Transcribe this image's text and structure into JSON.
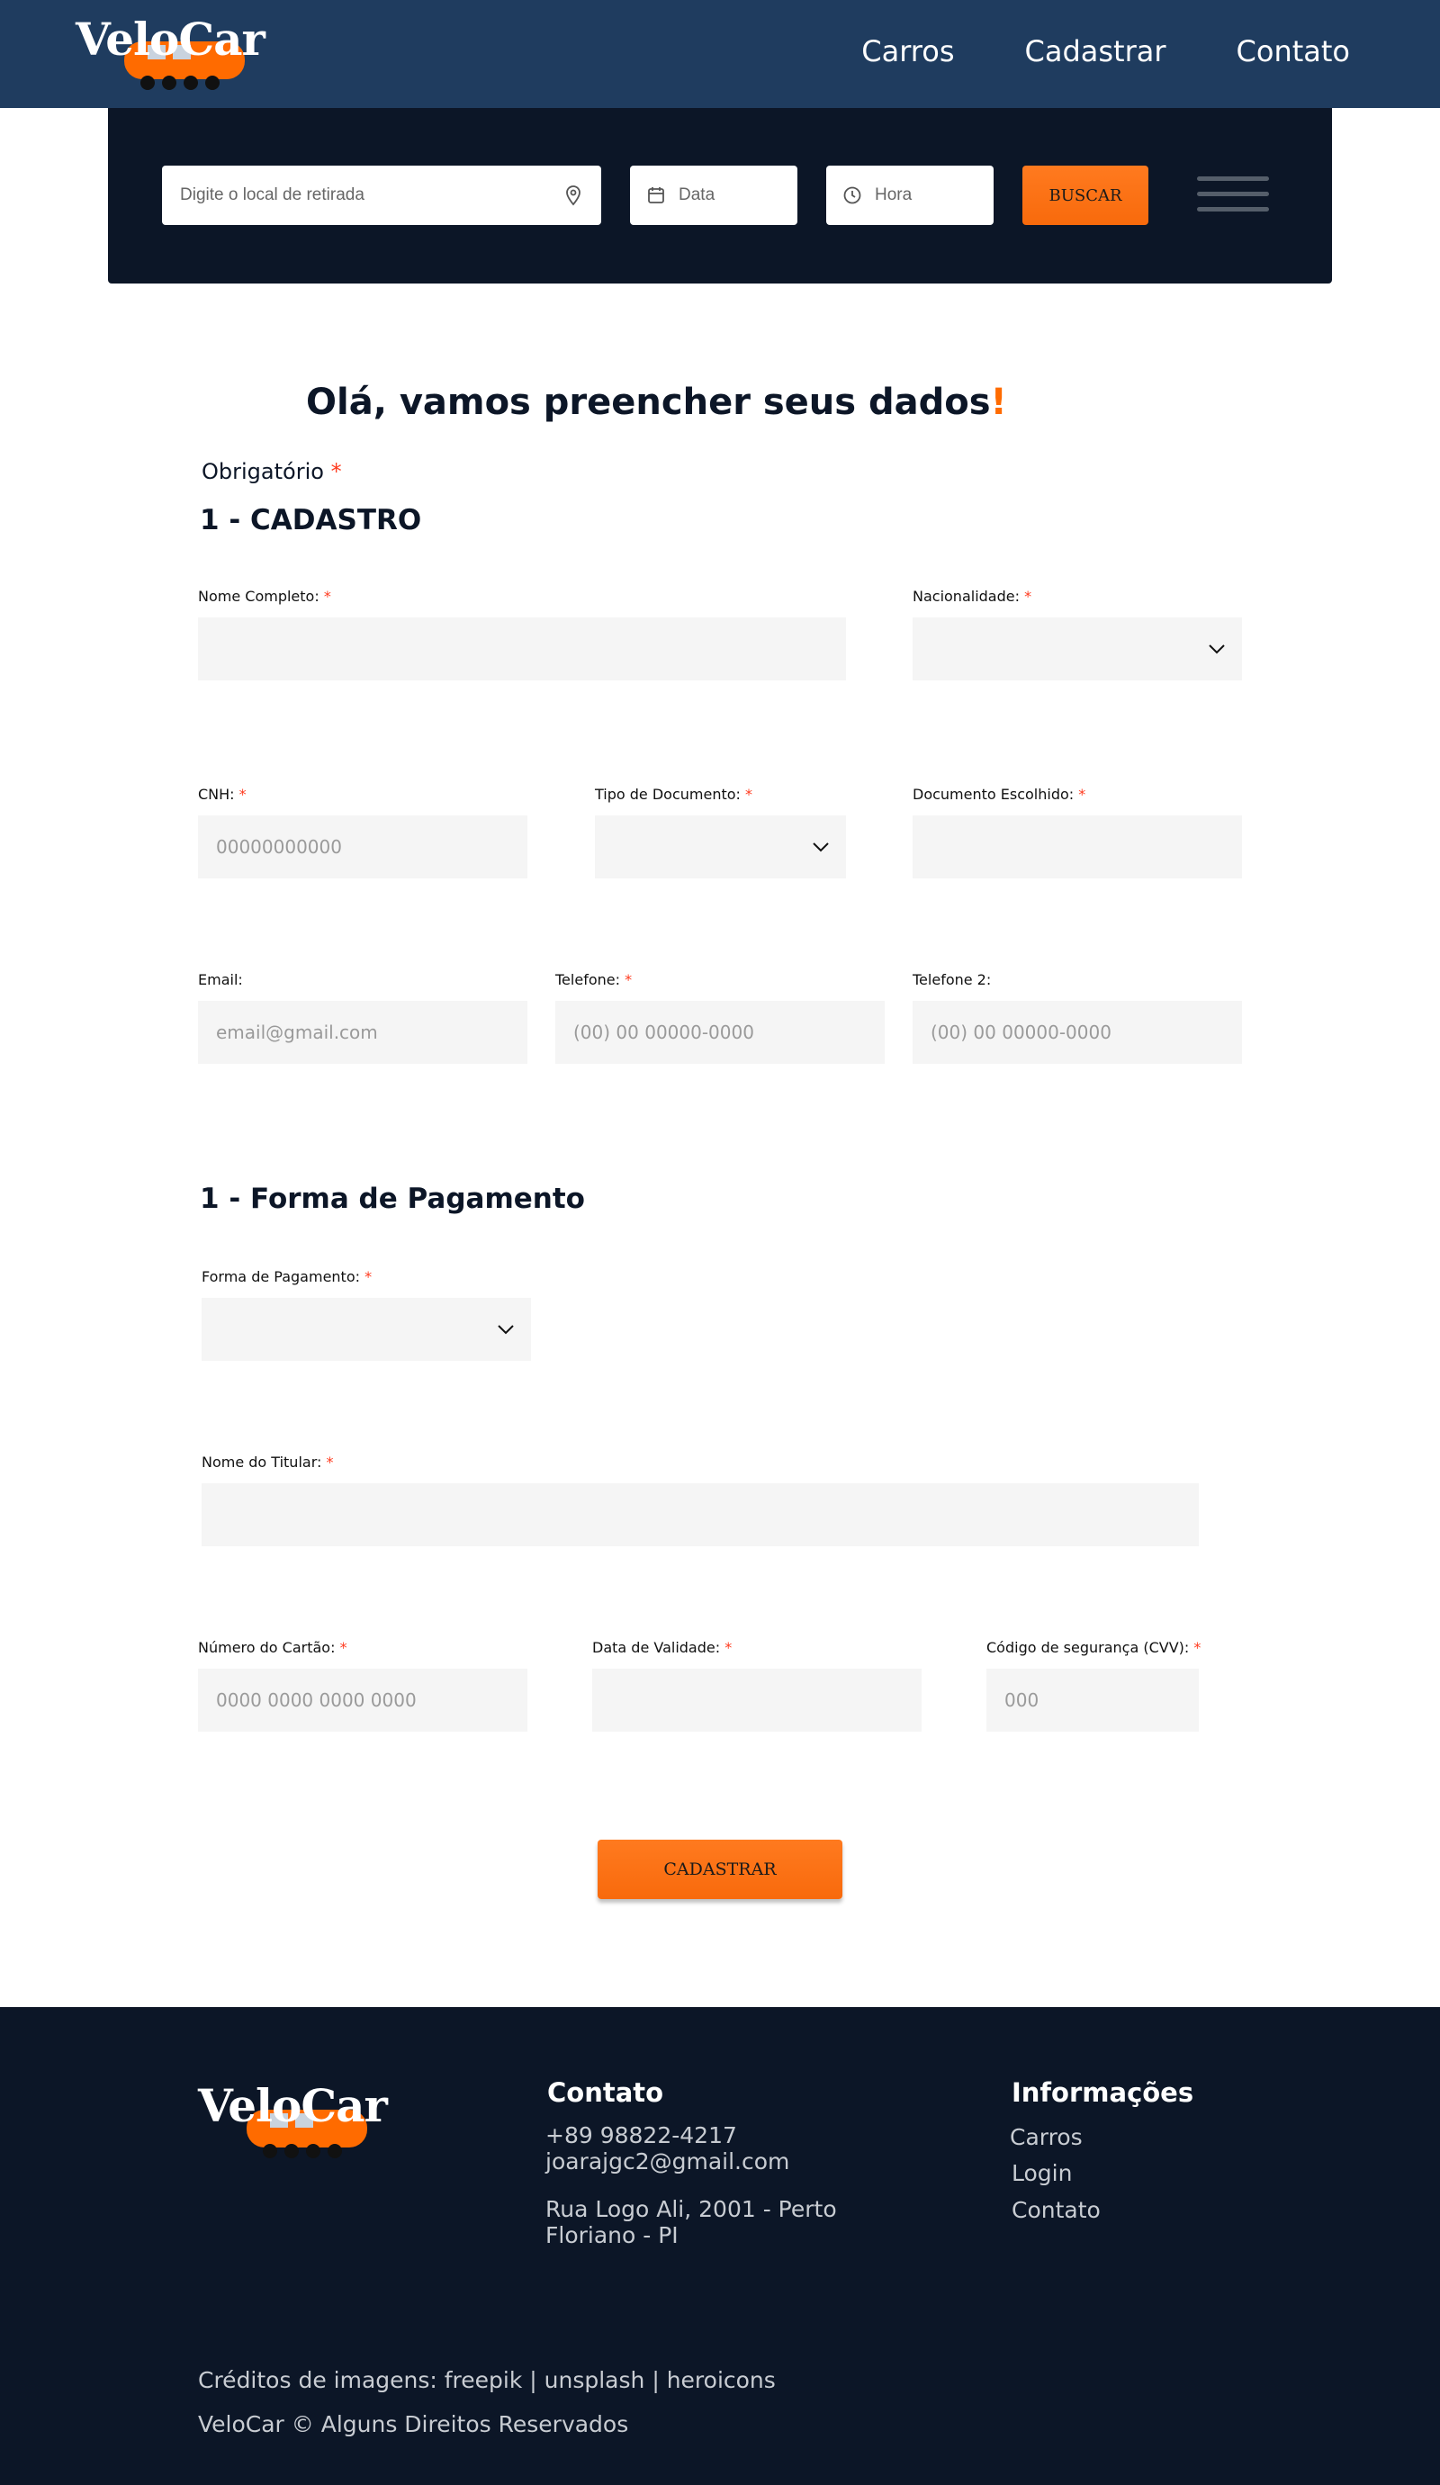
{
  "brand": {
    "name": "VeloCar",
    "accent": "#ff6b00",
    "header_bg": "#1f3c5f",
    "dark_bg": "#0c1627"
  },
  "nav": {
    "items": [
      "Carros",
      "Cadastrar",
      "Contato"
    ]
  },
  "search": {
    "location_placeholder": "Digite o local de retirada",
    "date_placeholder": "Data",
    "time_placeholder": "Hora",
    "button_label": "BUSCAR",
    "icons": [
      "location-pin-icon",
      "calendar-icon",
      "clock-icon",
      "hamburger-menu-icon"
    ]
  },
  "form": {
    "greeting": "Olá, vamos preencher seus dados",
    "greeting_mark": "!",
    "required_note": "Obrigatório",
    "required_marker": "*",
    "section1_title": "1 - CADASTRO",
    "fields": {
      "nome_completo": {
        "label": "Nome Completo:",
        "value": ""
      },
      "nacionalidade": {
        "label": "Nacionalidade:",
        "value": ""
      },
      "cnh": {
        "label": "CNH:",
        "placeholder": "00000000000"
      },
      "tipo_documento": {
        "label": "Tipo de Documento:",
        "value": ""
      },
      "documento_escolhido": {
        "label": "Documento Escolhido:",
        "value": ""
      },
      "email": {
        "label": "Email:",
        "placeholder": "email@gmail.com"
      },
      "telefone": {
        "label": "Telefone:",
        "placeholder": "(00) 00 00000-0000"
      },
      "telefone2": {
        "label": "Telefone 2:",
        "placeholder": "(00) 00 00000-0000"
      }
    },
    "section2_title": "1 - Forma de Pagamento",
    "payment": {
      "forma_pagamento": {
        "label": "Forma de Pagamento:",
        "value": ""
      },
      "nome_titular": {
        "label": "Nome do Titular:",
        "value": ""
      },
      "numero_cartao": {
        "label": "Número do Cartão:",
        "placeholder": "0000 0000 0000 0000"
      },
      "data_validade": {
        "label": "Data de Validade:",
        "value": ""
      },
      "cvv": {
        "label": "Código de segurança (CVV):",
        "placeholder": "000"
      }
    },
    "submit_label": "CADASTRAR"
  },
  "footer": {
    "contato_title": "Contato",
    "phone": "+89 98822-4217",
    "email": "joarajgc2@gmail.com",
    "address_line1": "Rua Logo Ali, 2001 - Perto",
    "address_line2": "Floriano - PI",
    "info_title": "Informações",
    "links": [
      "Carros",
      "Login",
      "Contato"
    ],
    "credits": "Créditos de imagens: freepik | unsplash | heroicons",
    "copyright": "VeloCar © Alguns Direitos Reservados"
  }
}
